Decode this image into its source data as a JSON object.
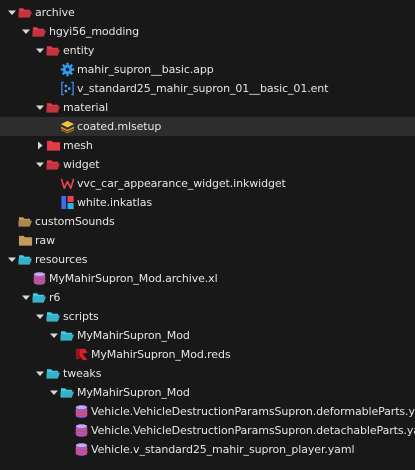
{
  "colors": {
    "background": "#181818",
    "selected_row": "#2d2d2d",
    "text": "#e6e6e6",
    "folder_archive": "#e23a47",
    "folder_resources": "#3ecbe6",
    "folder_plain": "#c69a5b"
  },
  "tree": [
    {
      "label": "archive",
      "depth": 0,
      "expanded": true,
      "icon": "red-folder-open-icon"
    },
    {
      "label": "hgyi56_modding",
      "depth": 1,
      "expanded": true,
      "icon": "red-folder-open-icon"
    },
    {
      "label": "entity",
      "depth": 2,
      "expanded": true,
      "icon": "red-folder-open-icon"
    },
    {
      "label": "mahir_supron__basic.app",
      "depth": 3,
      "icon": "gear-icon"
    },
    {
      "label": "v_standard25_mahir_supron_01__basic_01.ent",
      "depth": 3,
      "icon": "entity-file-icon"
    },
    {
      "label": "material",
      "depth": 2,
      "expanded": true,
      "icon": "red-folder-open-icon"
    },
    {
      "label": "coated.mlsetup",
      "depth": 3,
      "icon": "mlsetup-layers-icon",
      "selected": true
    },
    {
      "label": "mesh",
      "depth": 2,
      "expanded": false,
      "icon": "red-folder-closed-icon"
    },
    {
      "label": "widget",
      "depth": 2,
      "expanded": true,
      "icon": "red-folder-open-icon"
    },
    {
      "label": "vvc_car_appearance_widget.inkwidget",
      "depth": 3,
      "icon": "inkwidget-icon"
    },
    {
      "label": "white.inkatlas",
      "depth": 3,
      "icon": "inkatlas-icon"
    },
    {
      "label": "customSounds",
      "depth": 0,
      "icon": "folder-open-icon"
    },
    {
      "label": "raw",
      "depth": 0,
      "icon": "folder-closed-icon"
    },
    {
      "label": "resources",
      "depth": 0,
      "expanded": true,
      "icon": "cyan-folder-open-icon"
    },
    {
      "label": "MyMahirSupron_Mod.archive.xl",
      "depth": 1,
      "icon": "archive-xl-icon"
    },
    {
      "label": "r6",
      "depth": 1,
      "expanded": true,
      "icon": "cyan-folder-open-icon"
    },
    {
      "label": "scripts",
      "depth": 2,
      "expanded": true,
      "icon": "cyan-folder-open-icon"
    },
    {
      "label": "MyMahirSupron_Mod",
      "depth": 3,
      "expanded": true,
      "icon": "cyan-folder-open-icon"
    },
    {
      "label": "MyMahirSupron_Mod.reds",
      "depth": 4,
      "icon": "redscript-icon"
    },
    {
      "label": "tweaks",
      "depth": 2,
      "expanded": true,
      "icon": "cyan-folder-open-icon"
    },
    {
      "label": "MyMahirSupron_Mod",
      "depth": 3,
      "expanded": true,
      "icon": "cyan-folder-open-icon"
    },
    {
      "label": "Vehicle.VehicleDestructionParamsSupron.deformableParts.yaml",
      "depth": 4,
      "icon": "yaml-icon"
    },
    {
      "label": "Vehicle.VehicleDestructionParamsSupron.detachableParts.yaml",
      "depth": 4,
      "icon": "yaml-icon"
    },
    {
      "label": "Vehicle.v_standard25_mahir_supron_player.yaml",
      "depth": 4,
      "icon": "yaml-icon"
    }
  ]
}
